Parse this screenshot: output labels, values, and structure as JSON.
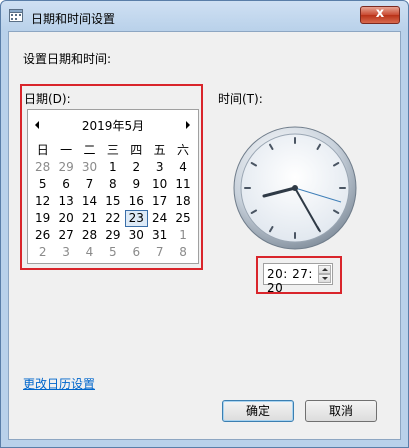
{
  "window": {
    "title": "日期和时间设置",
    "close_label": "x"
  },
  "heading": "设置日期和时间:",
  "date_label": "日期(D):",
  "time_label": "时间(T):",
  "calendar": {
    "month_label": "2019年5月",
    "weekdays": [
      "日",
      "一",
      "二",
      "三",
      "四",
      "五",
      "六"
    ],
    "weeks": [
      [
        "28",
        "29",
        "30",
        "1",
        "2",
        "3",
        "4"
      ],
      [
        "5",
        "6",
        "7",
        "8",
        "9",
        "10",
        "11"
      ],
      [
        "12",
        "13",
        "14",
        "15",
        "16",
        "17",
        "18"
      ],
      [
        "19",
        "20",
        "21",
        "22",
        "23",
        "24",
        "25"
      ],
      [
        "26",
        "27",
        "28",
        "29",
        "30",
        "31",
        "1"
      ],
      [
        "2",
        "3",
        "4",
        "5",
        "6",
        "7",
        "8"
      ]
    ],
    "selected_day": "23"
  },
  "time_value": "20: 27: 20",
  "change_calendar_link": "更改日历设置",
  "buttons": {
    "ok": "确定",
    "cancel": "取消"
  },
  "colors": {
    "highlight_border": "#d9252b",
    "link": "#0066cc"
  }
}
